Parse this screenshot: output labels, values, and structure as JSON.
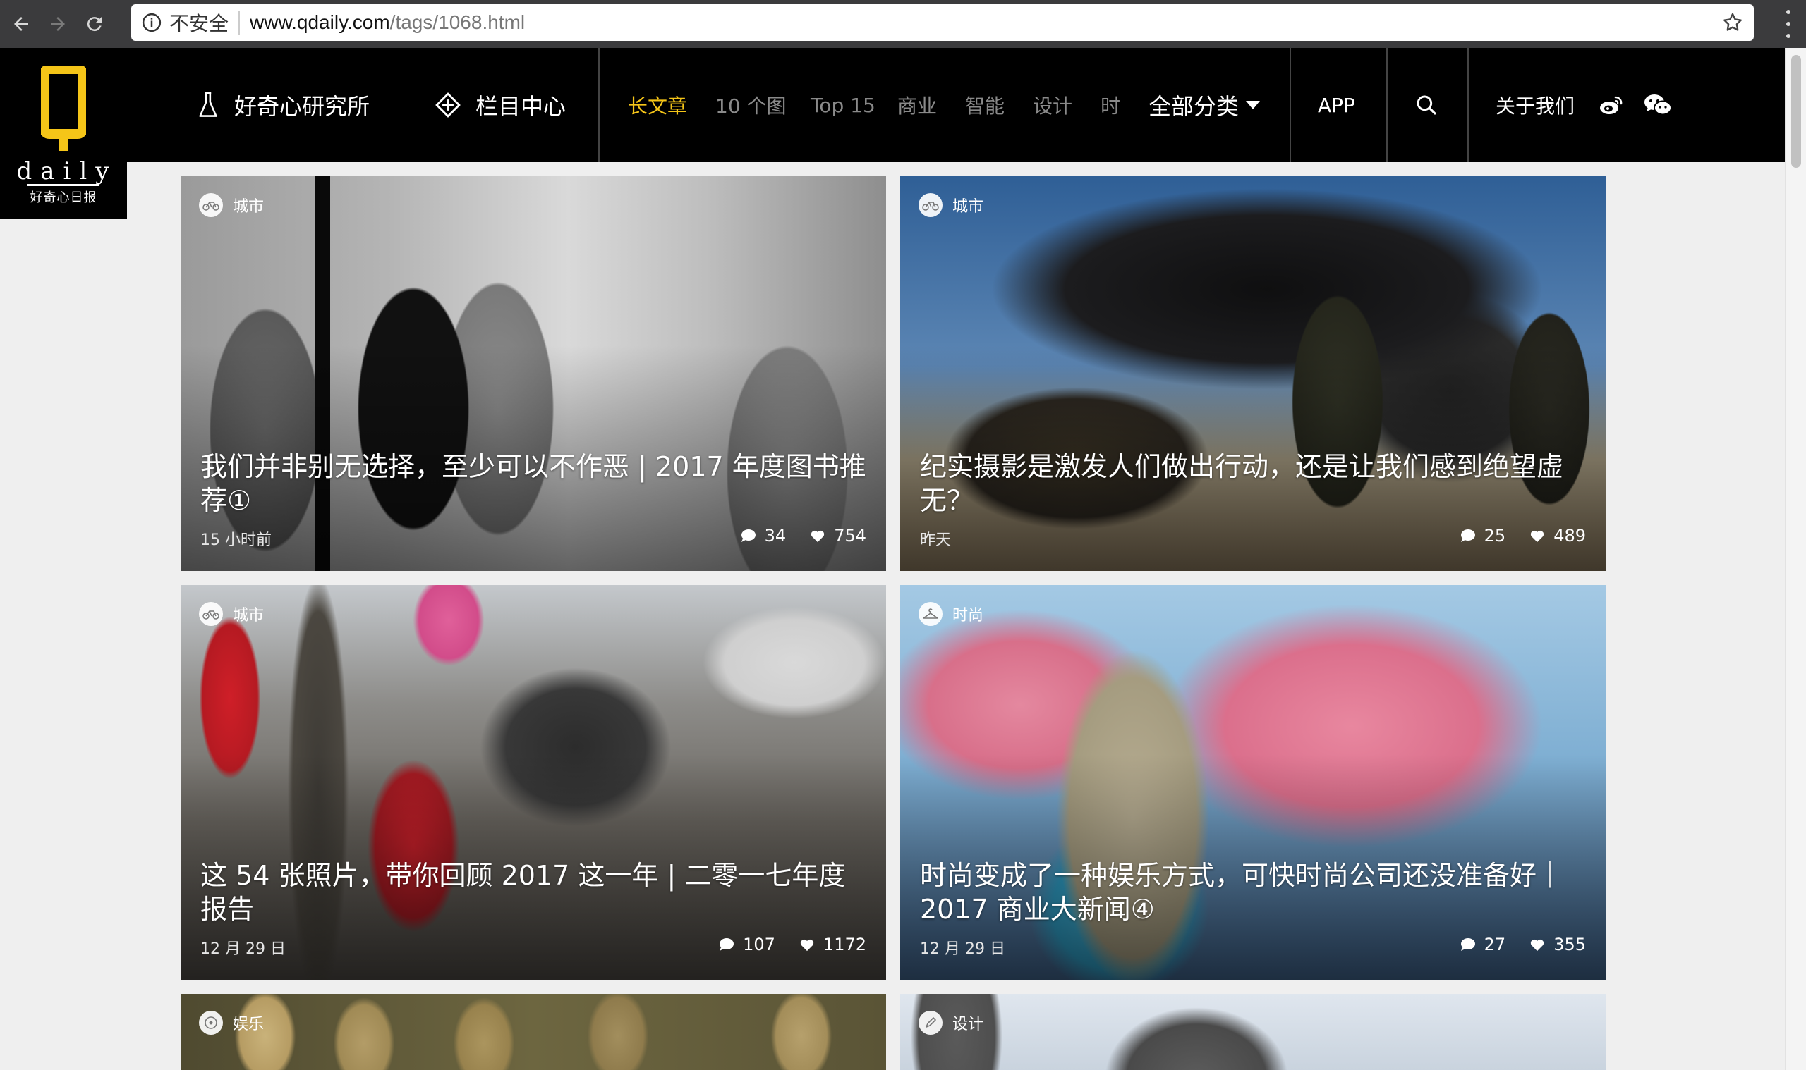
{
  "browser": {
    "insecure_label": "不安全",
    "url_host": "www.qdaily.com",
    "url_path": "/tags/1068.html"
  },
  "site": {
    "logo_letter": "Q",
    "logo_word": "daily",
    "logo_sub": "好奇心日报",
    "nav_lab": "好奇心研究所",
    "nav_column": "栏目中心",
    "categories": [
      "长文章",
      "10 个图",
      "Top 15",
      "商业",
      "智能",
      "设计",
      "时"
    ],
    "all_categories": "全部分类",
    "app": "APP",
    "about": "关于我们"
  },
  "colors": {
    "accent": "#f5c518",
    "header_bg": "#000000",
    "page_bg": "#efefef"
  },
  "cards": [
    {
      "tag": "城市",
      "tag_icon": "bicycle-icon",
      "title": "我们并非别无选择，至少可以不作恶 | 2017 年度图书推荐①",
      "date": "15 小时前",
      "comments": "34",
      "likes": "754"
    },
    {
      "tag": "城市",
      "tag_icon": "bicycle-icon",
      "title": "纪实摄影是激发人们做出行动，还是让我们感到绝望虚无？",
      "date": "昨天",
      "comments": "25",
      "likes": "489"
    },
    {
      "tag": "城市",
      "tag_icon": "bicycle-icon",
      "title": "这 54 张照片，带你回顾 2017 这一年 | 二零一七年度报告",
      "date": "12 月 29 日",
      "comments": "107",
      "likes": "1172"
    },
    {
      "tag": "时尚",
      "tag_icon": "hanger-icon",
      "title": "时尚变成了一种娱乐方式，可快时尚公司还没准备好｜2017 商业大新闻④",
      "date": "12 月 29 日",
      "comments": "27",
      "likes": "355"
    },
    {
      "tag": "娱乐",
      "tag_icon": "disc-icon"
    },
    {
      "tag": "设计",
      "tag_icon": "pen-icon"
    }
  ]
}
